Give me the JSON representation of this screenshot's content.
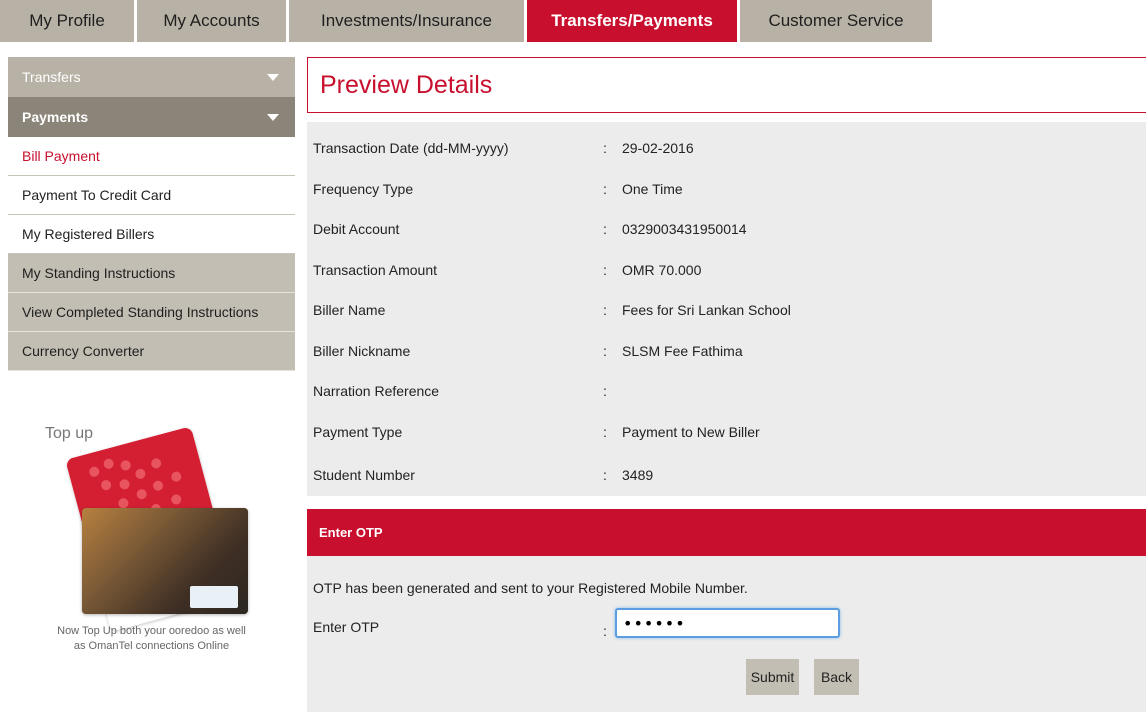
{
  "nav": {
    "tabs": [
      {
        "label": "My Profile"
      },
      {
        "label": "My Accounts"
      },
      {
        "label": "Investments/Insurance"
      },
      {
        "label": "Transfers/Payments"
      },
      {
        "label": "Customer Service"
      }
    ],
    "active": "Transfers/Payments"
  },
  "sidebar": {
    "transfers_label": "Transfers",
    "payments_label": "Payments",
    "items": [
      {
        "label": "Bill Payment"
      },
      {
        "label": "Payment To Credit Card"
      },
      {
        "label": "My Registered Billers"
      },
      {
        "label": "My Standing Instructions"
      },
      {
        "label": "View Completed Standing Instructions"
      },
      {
        "label": "Currency Converter"
      }
    ]
  },
  "promo": {
    "title": "Top up",
    "caption_line1": "Now Top Up both your ooredoo as well",
    "caption_line2": "as OmanTel connections Online"
  },
  "page": {
    "title": "Preview Details"
  },
  "details": [
    {
      "label": "Transaction Date (dd-MM-yyyy)",
      "value": "29-02-2016"
    },
    {
      "label": "Frequency Type",
      "value": "One Time"
    },
    {
      "label": "Debit Account",
      "value": "0329003431950014"
    },
    {
      "label": "Transaction Amount",
      "value": "OMR 70.000"
    },
    {
      "label": "Biller Name",
      "value": "Fees for Sri Lankan School"
    },
    {
      "label": "Biller Nickname",
      "value": "SLSM Fee Fathima"
    },
    {
      "label": "Narration Reference",
      "value": ""
    },
    {
      "label": "Payment Type",
      "value": "Payment to New Biller"
    },
    {
      "label": "Student Number",
      "value": "3489"
    }
  ],
  "colon": ":",
  "otp": {
    "header": "Enter OTP",
    "message": "OTP has been generated and sent to your Registered Mobile Number.",
    "label": "Enter OTP",
    "value": "••••••",
    "submit_label": "Submit",
    "back_label": "Back"
  },
  "colors": {
    "brand_red": "#c8102e",
    "tab_grey": "#b8b2a6",
    "panel_grey": "#ececec"
  }
}
